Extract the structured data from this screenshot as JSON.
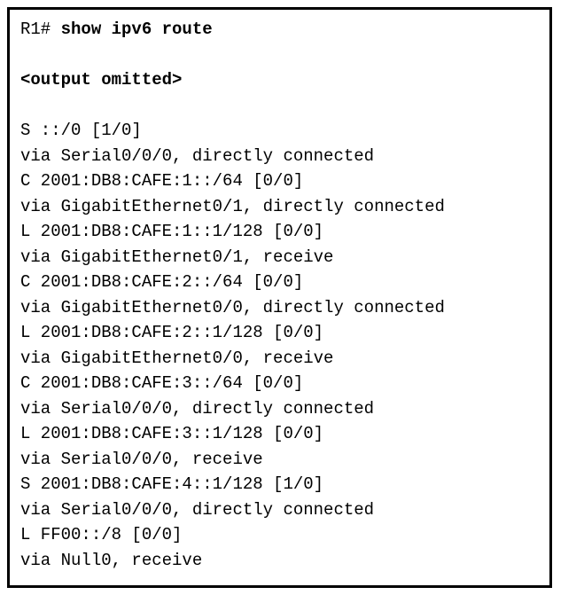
{
  "prompt": "R1# ",
  "command": "show ipv6 route",
  "omitted": "<output omitted>",
  "routes": [
    "S ::/0 [1/0]",
    "via Serial0/0/0, directly connected",
    "C 2001:DB8:CAFE:1::/64 [0/0]",
    "via GigabitEthernet0/1, directly connected",
    "L 2001:DB8:CAFE:1::1/128 [0/0]",
    "via GigabitEthernet0/1, receive",
    "C 2001:DB8:CAFE:2::/64 [0/0]",
    "via GigabitEthernet0/0, directly connected",
    "L 2001:DB8:CAFE:2::1/128 [0/0]",
    "via GigabitEthernet0/0, receive",
    "C 2001:DB8:CAFE:3::/64 [0/0]",
    "via Serial0/0/0, directly connected",
    "L 2001:DB8:CAFE:3::1/128 [0/0]",
    "via Serial0/0/0, receive",
    "S 2001:DB8:CAFE:4::1/128 [1/0]",
    "via Serial0/0/0, directly connected",
    "L FF00::/8 [0/0]",
    "via Null0, receive"
  ]
}
